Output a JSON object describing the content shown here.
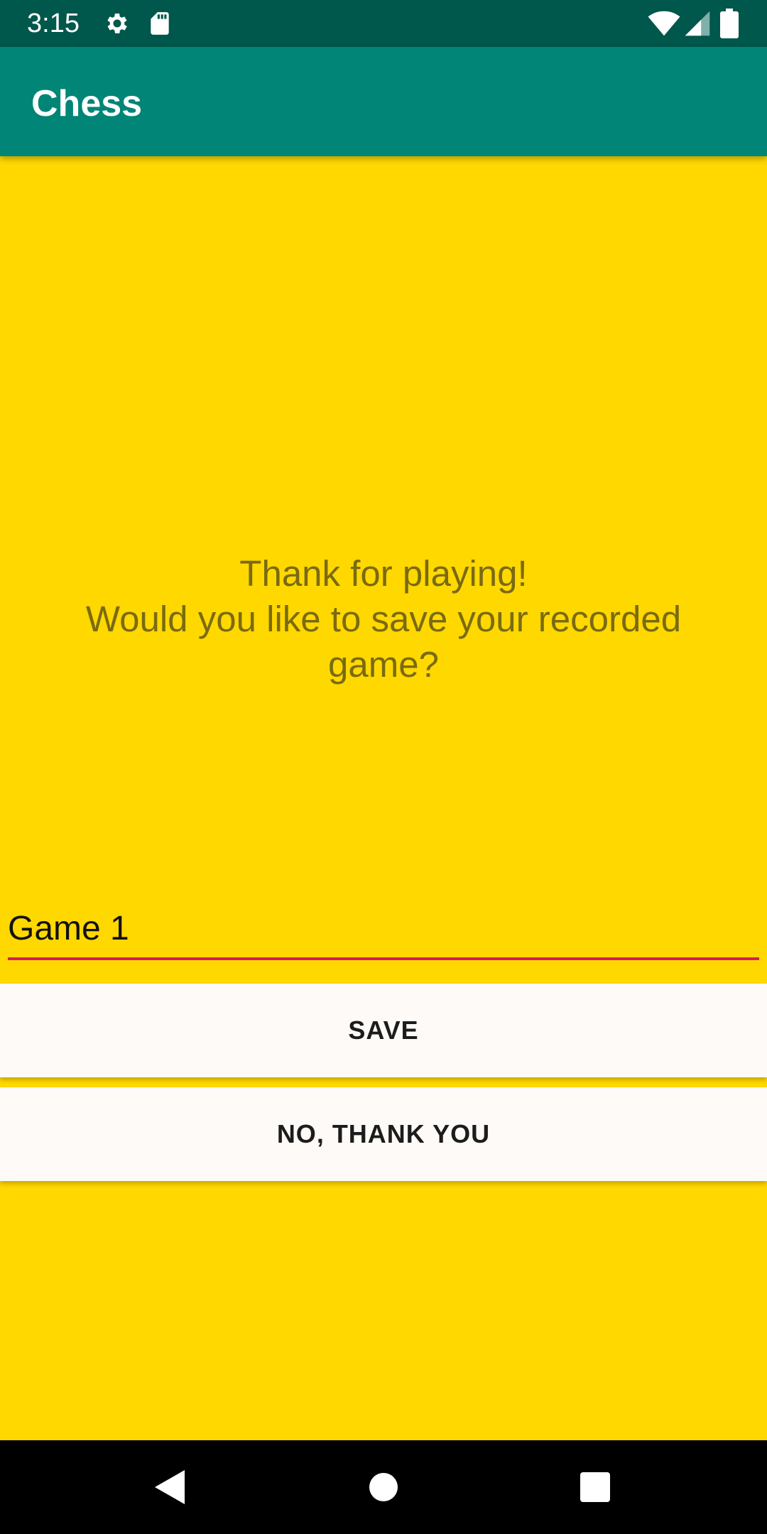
{
  "status_bar": {
    "time": "3:15",
    "icons": [
      "gear-icon",
      "sd-card-icon",
      "wifi-icon",
      "signal-icon",
      "battery-icon"
    ]
  },
  "app_bar": {
    "title": "Chess",
    "color": "#008577"
  },
  "main": {
    "background_color": "#FFD800",
    "message": "Thank for playing!\nWould you like to save your recorded\ngame?",
    "game_name_input": {
      "value": "Game 1",
      "underline_color": "#D81B60"
    },
    "save_button_label": "SAVE",
    "decline_button_label": "NO, THANK YOU"
  },
  "nav_bar": {
    "icons": [
      "back-icon",
      "home-icon",
      "recents-icon"
    ]
  }
}
